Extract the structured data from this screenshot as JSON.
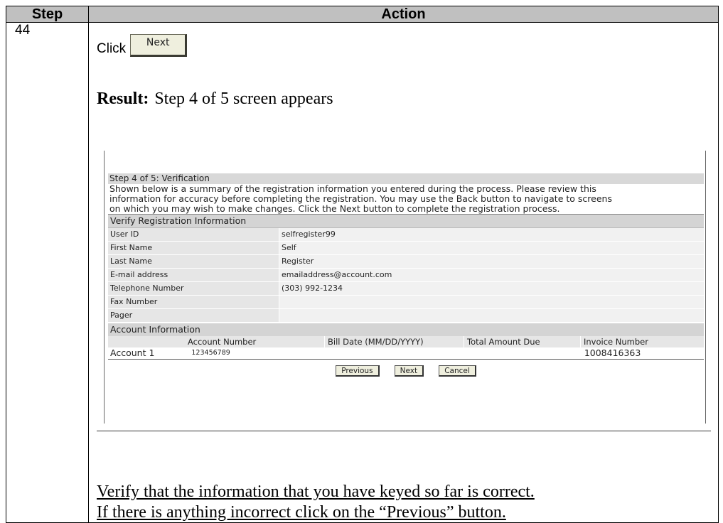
{
  "table": {
    "header_step": "Step",
    "header_action": "Action",
    "step_number": "44"
  },
  "instruction": {
    "click_text": "Click",
    "next_button_label": "Next"
  },
  "result": {
    "label": "Result:",
    "text": "Step 4 of 5 screen appears"
  },
  "screen": {
    "step_title": "Step 4 of 5: Verification",
    "intro_lines": [
      "Shown below is a summary of the registration information you entered during the process. Please review this",
      "information for accuracy before completing the registration. You may use the Back button to navigate to screens",
      "on which you may wish to make changes. Click the Next button to complete the registration process."
    ],
    "verify_heading": "Verify Registration Information",
    "fields": [
      {
        "label": "User ID",
        "value": "selfregister99"
      },
      {
        "label": "First Name",
        "value": "Self"
      },
      {
        "label": "Last Name",
        "value": "Register"
      },
      {
        "label": "E-mail address",
        "value": "emailaddress@account.com"
      },
      {
        "label": "Telephone Number",
        "value": "(303) 992-1234"
      },
      {
        "label": "Fax Number",
        "value": ""
      },
      {
        "label": "Pager",
        "value": ""
      }
    ],
    "account_heading": "Account Information",
    "account_columns": [
      "Account Number",
      "Bill Date (MM/DD/YYYY)",
      "Total Amount Due",
      "Invoice Number"
    ],
    "account_row": {
      "label": "Account 1",
      "account_number": "123456789",
      "bill_date": "",
      "total_due": "",
      "invoice_number": "1008416363"
    },
    "buttons": {
      "previous": "Previous",
      "next": "Next",
      "cancel": "Cancel"
    }
  },
  "note_lines": [
    "Verify that the information that you have keyed so far is correct.",
    "If there is anything incorrect click on the “Previous” button."
  ]
}
